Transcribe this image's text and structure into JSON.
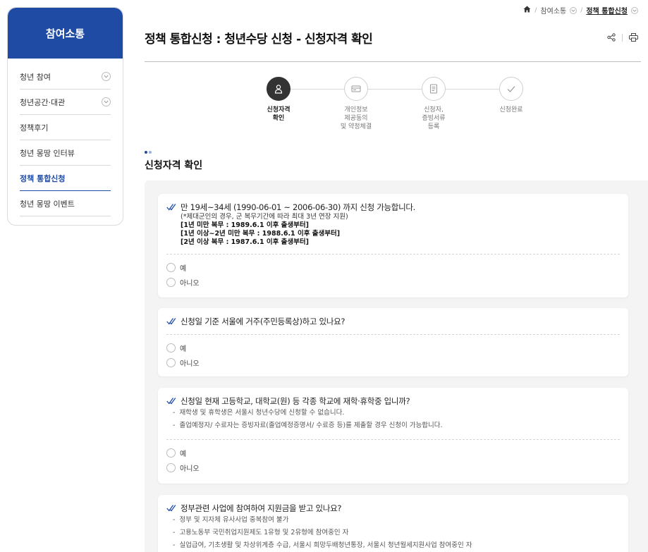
{
  "sidebar": {
    "title": "참여소통",
    "items": [
      {
        "label": "청년 참여",
        "has_sub": true,
        "active": false
      },
      {
        "label": "청년공간·대관",
        "has_sub": true,
        "active": false
      },
      {
        "label": "정책후기",
        "has_sub": false,
        "active": false
      },
      {
        "label": "청년 몽땅 인터뷰",
        "has_sub": false,
        "active": false
      },
      {
        "label": "정책 통합신청",
        "has_sub": false,
        "active": true
      },
      {
        "label": "청년 몽땅 이벤트",
        "has_sub": false,
        "active": false
      }
    ]
  },
  "breadcrumb": {
    "home_icon": "home-icon",
    "level1": "참여소통",
    "current": "정책 통합신청"
  },
  "page": {
    "title": "정책 통합신청 : 청년수당 신청 - 신청자격 확인",
    "share_icon": "share-icon",
    "print_icon": "print-icon"
  },
  "steps": [
    {
      "label": "신청자격\n확인",
      "icon": "user-icon",
      "active": true
    },
    {
      "label": "개인정보\n제공동의\n및 약정체결",
      "icon": "card-icon",
      "active": false
    },
    {
      "label": "신청자,\n증빙서류\n등록",
      "icon": "document-icon",
      "active": false
    },
    {
      "label": "신청완료",
      "icon": "check-icon",
      "active": false
    }
  ],
  "section": {
    "title": "신청자격 확인"
  },
  "questions": [
    {
      "text": "만 19세~34세 (1990-06-01 ~ 2006-06-30) 까지 신청 가능합니다.",
      "subs": [
        {
          "text": "(*제대군인의 경우, 군 복무기간에 따라 최대 3년 연장 지원)",
          "bold": false
        },
        {
          "text": "[1년 미만 복무 : 1989.6.1 이후 출생부터]",
          "bold": true
        },
        {
          "text": "[1년 이상~2년 미만 복무 : 1988.6.1 이후 출생부터]",
          "bold": true
        },
        {
          "text": "[2년 이상 복무 : 1987.6.1 이후 출생부터]",
          "bold": true
        }
      ],
      "notes": [],
      "options": [
        "예",
        "아니오"
      ]
    },
    {
      "text": "신청일 기준 서울에 거주(주민등록상)하고 있나요?",
      "subs": [],
      "notes": [],
      "options": [
        "예",
        "아니오"
      ]
    },
    {
      "text": "신청일 현재 고등학교, 대학교(원) 등 각종 학교에 재학·휴학중 입니까?",
      "subs": [],
      "notes": [
        "재학생 및 휴학생은 서울시 청년수당에 신청할 수 없습니다.",
        "졸업예정자/ 수료자는 증빙자료(졸업예정증명서/ 수료증 등)를 제출할 경우 신청이 가능합니다."
      ],
      "options": [
        "예",
        "아니오"
      ]
    },
    {
      "text": "정부관련 사업에 참여하여 지원금을 받고 있나요?",
      "subs": [],
      "notes": [
        "정부 및 지자체 유사사업 중복참여 불가",
        "고용노동부 국민취업지원제도 1유형 및 2유형에 참여중인 자",
        "실업급여, 기초생활 및 차상위계층 수급, 서울시 희망두배청년통장, 서울시 청년월세지원사업 참여중인 자"
      ],
      "options": []
    }
  ]
}
